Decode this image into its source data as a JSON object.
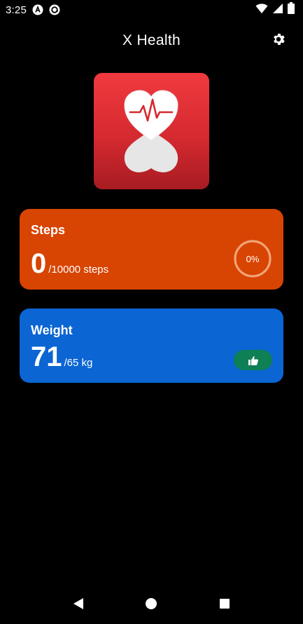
{
  "status_bar": {
    "time": "3:25",
    "icons": [
      "notification-a-icon",
      "notification-at-icon",
      "wifi-icon",
      "signal-icon",
      "battery-icon"
    ]
  },
  "app_bar": {
    "title": "X Health",
    "settings_icon": "gear-icon"
  },
  "logo": {
    "icon": "heart-pulse-icon"
  },
  "steps_card": {
    "title": "Steps",
    "value": "0",
    "goal_text": "/10000 steps",
    "progress_label": "0%",
    "progress_fraction": 0,
    "color": "#d84402"
  },
  "weight_card": {
    "title": "Weight",
    "value": "71",
    "goal_text": "/65 kg",
    "status_icon": "thumbs-up-icon",
    "color": "#0b65d3",
    "pill_color": "#0f7f55"
  },
  "nav_bar": {
    "icons": [
      "back-icon",
      "home-icon",
      "recents-icon"
    ]
  }
}
